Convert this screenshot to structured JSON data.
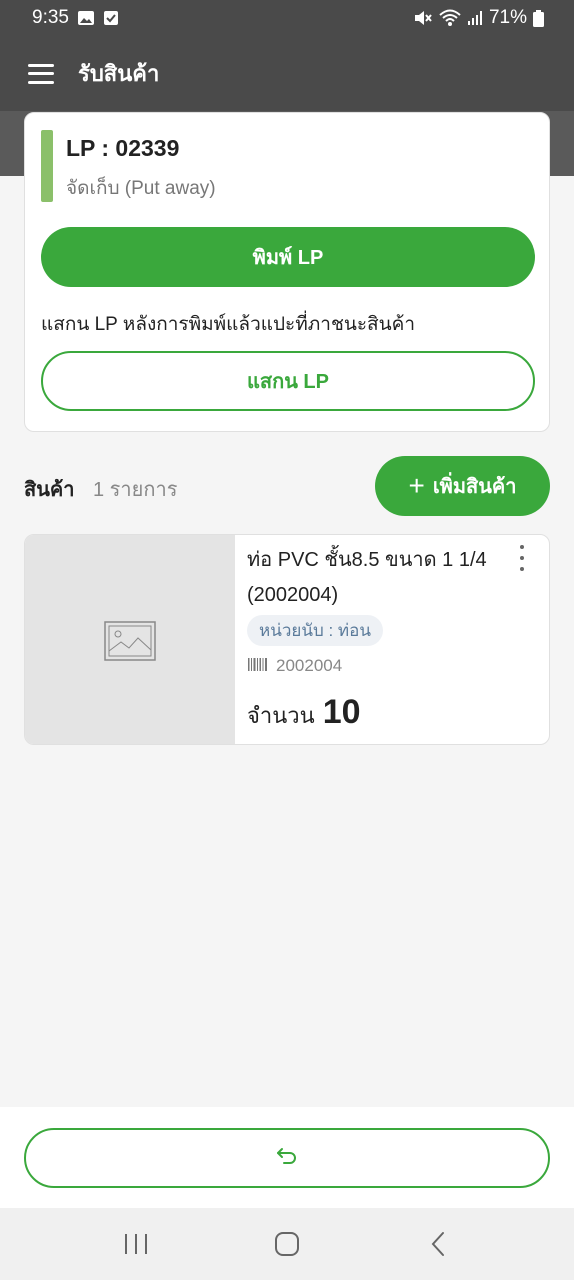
{
  "status_bar": {
    "time": "9:35",
    "battery": "71%",
    "icons_left": [
      "gallery-icon",
      "check-box-icon"
    ],
    "icons_right": [
      "mute-icon",
      "wifi-icon",
      "signal-icon",
      "battery-icon"
    ]
  },
  "app_bar": {
    "title": "รับสินค้า",
    "menu_icon": "hamburger-menu-icon"
  },
  "lp_card": {
    "title": "LP : 02339",
    "status": "จัดเก็บ (Put away)",
    "print_button": "พิมพ์ LP",
    "hint": "แสกน LP หลังการพิมพ์แล้วแปะที่ภาชนะสินค้า",
    "scan_button": "แสกน LP",
    "accent_color": "#8bc06a"
  },
  "products_section": {
    "label": "สินค้า",
    "count": "1 รายการ",
    "add_button": "เพิ่มสินค้า"
  },
  "products": [
    {
      "name": "ท่อ PVC ชั้น8.5 ขนาด 1 1/4 (2002004)",
      "unit": "หน่วยนับ : ท่อน",
      "barcode": "2002004",
      "qty_label": "จำนวน",
      "qty": "10",
      "image": "image-placeholder-icon"
    }
  ],
  "bottom": {
    "back_icon": "undo-arrow-icon"
  },
  "theme": {
    "primary": "#3aa83c",
    "header": "#4a4a4a"
  }
}
